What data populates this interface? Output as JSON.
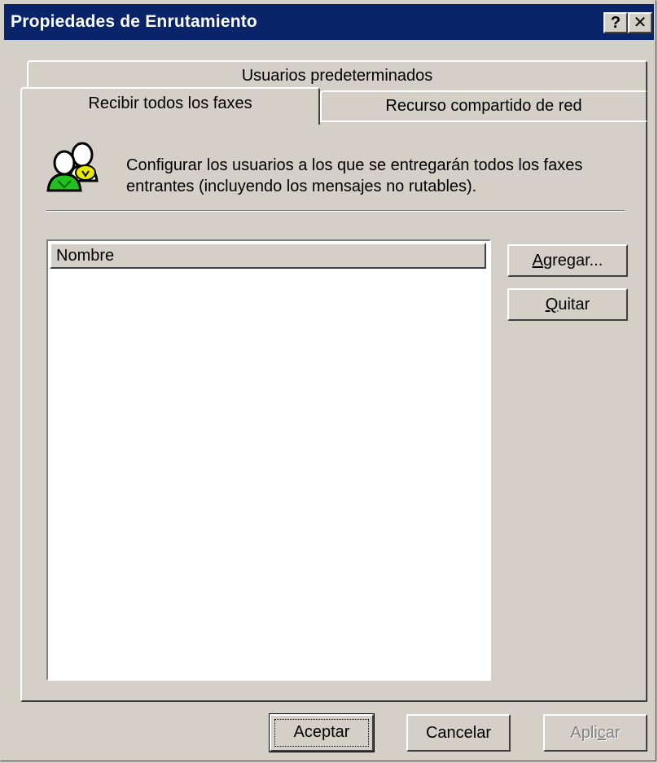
{
  "window": {
    "title": "Propiedades de Enrutamiento",
    "help_label": "?",
    "close_label": "✕"
  },
  "tabs": {
    "row1": [
      "Usuarios predeterminados"
    ],
    "row2": [
      "Recibir todos los faxes",
      "Recurso compartido de red"
    ],
    "active": "Recibir todos los faxes"
  },
  "panel": {
    "icon": "users-icon",
    "description_line1": "Configurar los usuarios a los que se entregarán todos los faxes",
    "description_line2": "entrantes (incluyendo los mensajes no rutables).",
    "list": {
      "columns": [
        "Nombre"
      ],
      "rows": []
    },
    "buttons": {
      "add": {
        "pre": "",
        "mnemonic": "A",
        "post": "gregar..."
      },
      "remove": {
        "pre": "",
        "mnemonic": "Q",
        "post": "uitar"
      }
    }
  },
  "footer": {
    "ok": "Aceptar",
    "cancel": "Cancelar",
    "apply": {
      "pre": "Apli",
      "mnemonic": "c",
      "post": "ar",
      "disabled": true
    }
  },
  "colors": {
    "titlebar": "#0a246a",
    "face": "#d4d0c8"
  }
}
